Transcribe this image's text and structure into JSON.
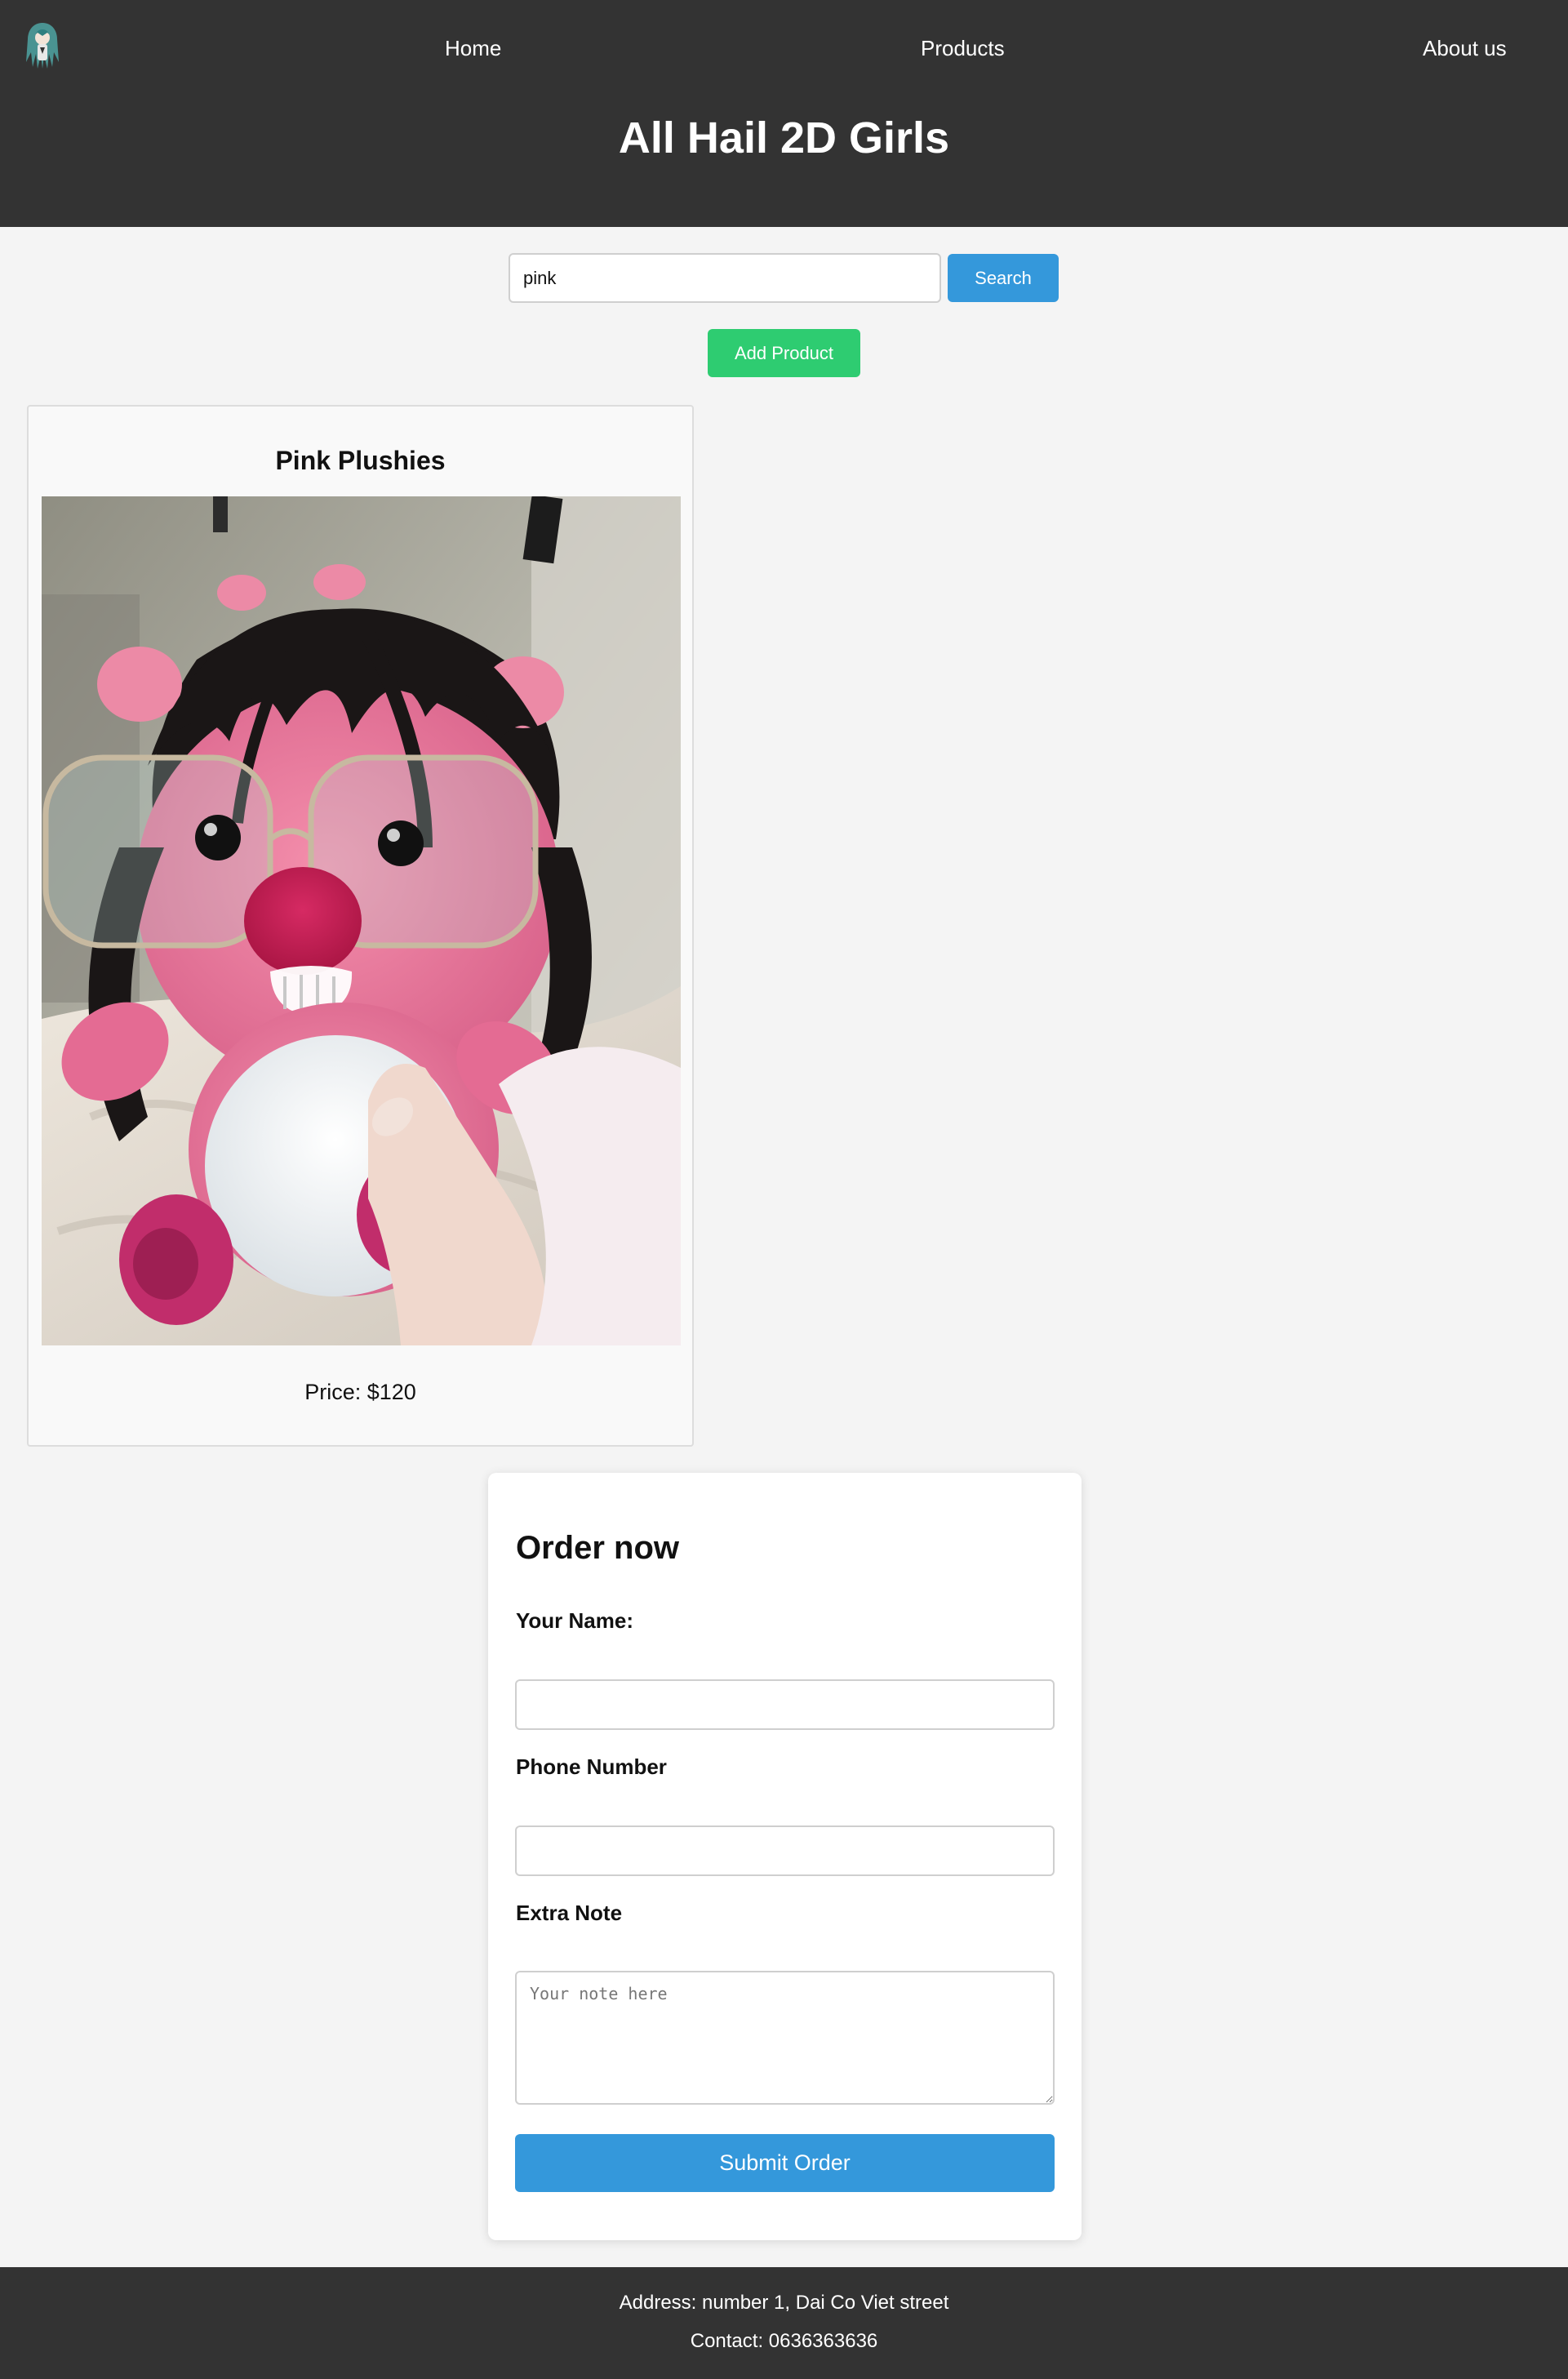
{
  "header": {
    "logo_icon": "anime-girl-logo-icon",
    "nav": {
      "home": "Home",
      "products": "Products",
      "about": "About us"
    },
    "title": "All Hail 2D Girls"
  },
  "search": {
    "value": "pink",
    "button_label": "Search"
  },
  "actions": {
    "add_product_label": "Add Product"
  },
  "products": [
    {
      "name": "Pink Plushies",
      "image_icon": "pink-plushie-photo",
      "price": "Price: $120"
    }
  ],
  "order_form": {
    "title": "Order now",
    "name_label": "Your Name:",
    "name_value": "",
    "phone_label": "Phone Number",
    "phone_value": "",
    "note_label": "Extra Note",
    "note_placeholder": "Your note here",
    "submit_label": "Submit Order"
  },
  "footer": {
    "address": "Address: number 1, Dai Co Viet street",
    "contact": "Contact: 0636363636"
  },
  "colors": {
    "header_bg": "#333333",
    "page_bg": "#f4f4f4",
    "primary_blue": "#3498db",
    "add_green": "#2ecc71"
  }
}
